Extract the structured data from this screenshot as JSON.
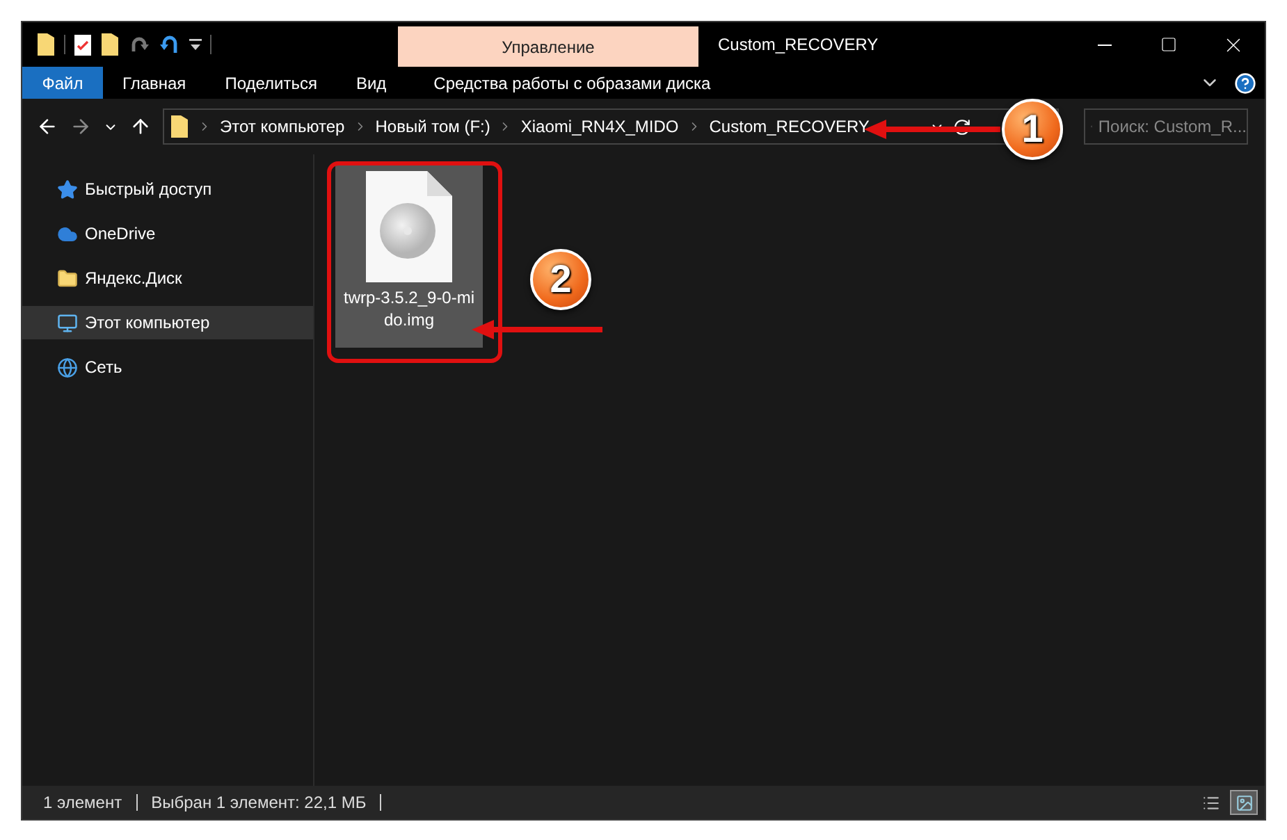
{
  "window": {
    "title": "Custom_RECOVERY"
  },
  "ribbon": {
    "context_group": "Управление",
    "tabs": [
      {
        "label": "Файл",
        "kind": "file"
      },
      {
        "label": "Главная",
        "kind": "tab"
      },
      {
        "label": "Поделиться",
        "kind": "tab"
      },
      {
        "label": "Вид",
        "kind": "tab"
      },
      {
        "label": "Средства работы с образами диска",
        "kind": "context"
      }
    ]
  },
  "address": {
    "breadcrumbs": [
      "Этот компьютер",
      "Новый том (F:)",
      "Xiaomi_RN4X_MIDO",
      "Custom_RECOVERY"
    ],
    "search_placeholder": "Поиск: Custom_R..."
  },
  "sidebar": {
    "items": [
      {
        "label": "Быстрый доступ",
        "selected": false
      },
      {
        "label": "OneDrive",
        "selected": false
      },
      {
        "label": "Яндекс.Диск",
        "selected": false
      },
      {
        "label": "Этот компьютер",
        "selected": true
      },
      {
        "label": "Сеть",
        "selected": false
      }
    ]
  },
  "files": [
    {
      "name": "twrp-3.5.2_9-0-mido.img",
      "selected": true
    }
  ],
  "status_bar": {
    "count": "1 элемент",
    "selection": "Выбран 1 элемент: 22,1 МБ",
    "views": [
      {
        "selected": false
      },
      {
        "selected": true
      }
    ]
  },
  "annotations": [
    {
      "label": "1"
    },
    {
      "label": "2"
    }
  ]
}
